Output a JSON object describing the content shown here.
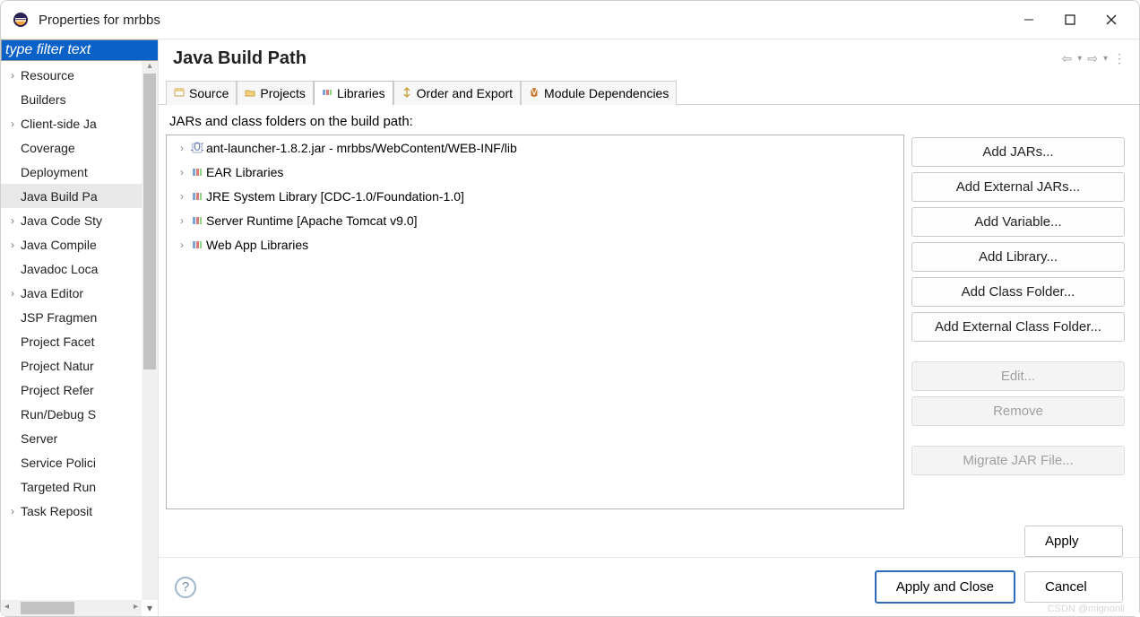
{
  "window": {
    "title": "Properties for mrbbs"
  },
  "sidebar": {
    "filter_placeholder": "type filter text",
    "items": [
      {
        "label": "Resource",
        "expandable": true
      },
      {
        "label": "Builders",
        "expandable": false
      },
      {
        "label": "Client-side Ja",
        "expandable": true
      },
      {
        "label": "Coverage",
        "expandable": false
      },
      {
        "label": "Deployment",
        "expandable": false
      },
      {
        "label": "Java Build Pa",
        "expandable": false,
        "selected": true
      },
      {
        "label": "Java Code Sty",
        "expandable": true
      },
      {
        "label": "Java Compile",
        "expandable": true
      },
      {
        "label": "Javadoc Loca",
        "expandable": false
      },
      {
        "label": "Java Editor",
        "expandable": true
      },
      {
        "label": "JSP Fragmen",
        "expandable": false
      },
      {
        "label": "Project Facet",
        "expandable": false
      },
      {
        "label": "Project Natur",
        "expandable": false
      },
      {
        "label": "Project Refer",
        "expandable": false
      },
      {
        "label": "Run/Debug S",
        "expandable": false
      },
      {
        "label": "Server",
        "expandable": false
      },
      {
        "label": "Service Polici",
        "expandable": false
      },
      {
        "label": "Targeted Run",
        "expandable": false
      },
      {
        "label": "Task Reposit",
        "expandable": true
      }
    ]
  },
  "main": {
    "title": "Java Build Path",
    "tabs": [
      {
        "label": "Source"
      },
      {
        "label": "Projects"
      },
      {
        "label": "Libraries",
        "active": true
      },
      {
        "label": "Order and Export"
      },
      {
        "label": "Module Dependencies"
      }
    ],
    "panel_desc": "JARs and class folders on the build path:",
    "jars": [
      {
        "label": "ant-launcher-1.8.2.jar - mrbbs/WebContent/WEB-INF/lib",
        "kind": "jar"
      },
      {
        "label": "EAR Libraries",
        "kind": "lib"
      },
      {
        "label": "JRE System Library [CDC-1.0/Foundation-1.0]",
        "kind": "lib"
      },
      {
        "label": "Server Runtime [Apache Tomcat v9.0]",
        "kind": "lib"
      },
      {
        "label": "Web App Libraries",
        "kind": "lib"
      }
    ],
    "buttons": {
      "add_jars": "Add JARs...",
      "add_external_jars": "Add External JARs...",
      "add_variable": "Add Variable...",
      "add_library": "Add Library...",
      "add_class_folder": "Add Class Folder...",
      "add_external_class_folder": "Add External Class Folder...",
      "edit": "Edit...",
      "remove": "Remove",
      "migrate": "Migrate JAR File...",
      "apply": "Apply"
    },
    "footer": {
      "apply_close": "Apply and Close",
      "cancel": "Cancel"
    }
  },
  "watermark": "CSDN @mignonli"
}
